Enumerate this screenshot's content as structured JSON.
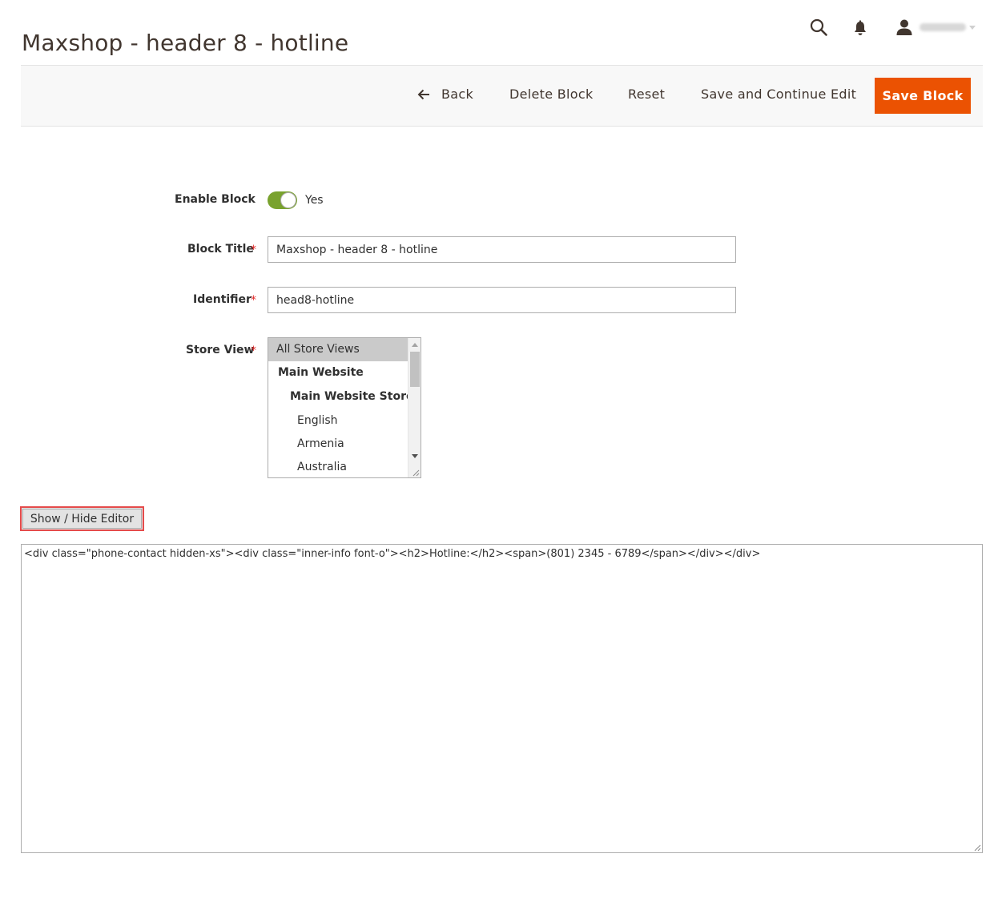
{
  "page": {
    "title": "Maxshop - header 8 - hotline"
  },
  "header": {
    "search_icon": "search-icon",
    "notifications_icon": "bell-icon",
    "user_icon": "user-icon"
  },
  "actions": {
    "back_label": "Back",
    "delete_label": "Delete Block",
    "reset_label": "Reset",
    "save_continue_label": "Save and Continue Edit",
    "save_label": "Save Block"
  },
  "form": {
    "enable": {
      "label": "Enable Block",
      "value_label": "Yes",
      "enabled": true
    },
    "title": {
      "label": "Block Title",
      "required_mark": "*",
      "value": "Maxshop - header 8 - hotline"
    },
    "identifier": {
      "label": "Identifier",
      "required_mark": "*",
      "value": "head8-hotline"
    },
    "store_view": {
      "label": "Store View",
      "required_mark": "*",
      "options": [
        {
          "label": "All Store Views",
          "selected": true,
          "group": false
        },
        {
          "label": "Main Website",
          "selected": false,
          "group": true
        },
        {
          "label": "Main Website Store",
          "selected": false,
          "group": true
        },
        {
          "label": "English",
          "selected": false,
          "group": false
        },
        {
          "label": "Armenia",
          "selected": false,
          "group": false
        },
        {
          "label": "Australia",
          "selected": false,
          "group": false
        }
      ]
    }
  },
  "editor": {
    "toggle_label": "Show / Hide Editor",
    "content": "<div class=\"phone-contact hidden-xs\"><div class=\"inner-info font-o\"><h2>Hotline:</h2><span>(801) 2345 - 6789</span></div></div>"
  },
  "colors": {
    "primary_action": "#eb5202",
    "toggle_on": "#79a22e",
    "required": "#e22626",
    "highlight_border": "#e54b4b"
  }
}
